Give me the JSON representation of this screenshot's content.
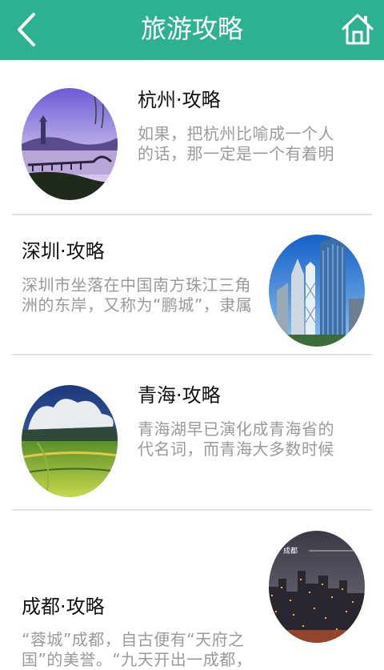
{
  "header": {
    "title": "旅游攻略",
    "back_icon": "chevron-left-icon",
    "home_icon": "home-icon",
    "bg_color": "#2eb191"
  },
  "items": [
    {
      "title": "杭州·攻略",
      "desc": "如果，把杭州比喻成一个人的话，那一定是一个有着明亮双"
    },
    {
      "title": "深圳·攻略",
      "desc": "深圳市坐落在中国南方珠江三角洲的东岸，又称为“鹏城”，隶属于中"
    },
    {
      "title": "青海·攻略",
      "desc": "青海湖早已演化成青海省的代名词，而青海大多数时候都被"
    },
    {
      "title": "成都·攻略",
      "desc": "“蓉城”成都，自古便有“天府之国”的美誉。“九天开出一成都，万",
      "image_caption": "成都"
    }
  ]
}
